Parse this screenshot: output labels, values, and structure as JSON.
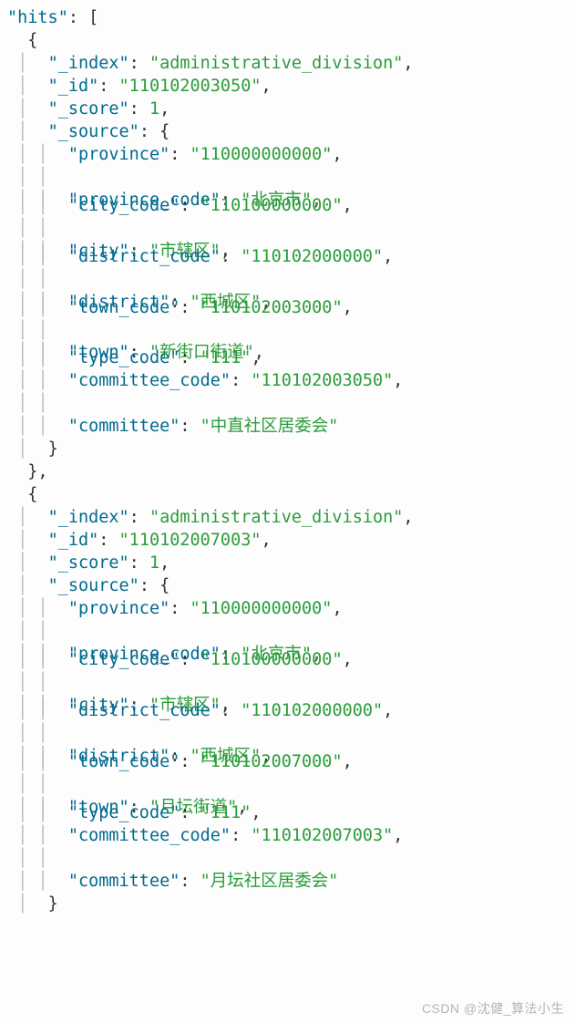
{
  "hits_key": "\"hits\"",
  "open_arr": ": [",
  "obj_open": "{",
  "obj_close": "}",
  "obj_close_comma": "},",
  "src_close": "}",
  "items": [
    {
      "index_k": "\"_index\"",
      "index_v": "\"administrative_division\"",
      "id_k": "\"_id\"",
      "id_v": "\"110102003050\"",
      "score_k": "\"_score\"",
      "score_v": "1",
      "source_k": "\"_source\"",
      "province_k": "\"province\"",
      "province_v": "\"110000000000\"",
      "province_code_k": "\"province_code\"",
      "province_code_v": "\"北京市\"",
      "city_code_k": "\"city_code\"",
      "city_code_v": "\"110100000000\"",
      "city_k": "\"city\"",
      "city_v": "\"市辖区\"",
      "district_code_k": "\"district_code\"",
      "district_code_v": "\"110102000000\"",
      "district_k": "\"district\"",
      "district_v": "\"西城区\"",
      "town_code_k": "\"town_code\"",
      "town_code_v": "\"110102003000\"",
      "town_k": "\"town\"",
      "town_v": "\"新街口街道\"",
      "type_code_k": "\"type_code\"",
      "type_code_v": "\"111\"",
      "committee_code_k": "\"committee_code\"",
      "committee_code_v": "\"110102003050\"",
      "committee_k": "\"committee\"",
      "committee_v": "\"中直社区居委会\""
    },
    {
      "index_k": "\"_index\"",
      "index_v": "\"administrative_division\"",
      "id_k": "\"_id\"",
      "id_v": "\"110102007003\"",
      "score_k": "\"_score\"",
      "score_v": "1",
      "source_k": "\"_source\"",
      "province_k": "\"province\"",
      "province_v": "\"110000000000\"",
      "province_code_k": "\"province_code\"",
      "province_code_v": "\"北京市\"",
      "city_code_k": "\"city_code\"",
      "city_code_v": "\"110100000000\"",
      "city_k": "\"city\"",
      "city_v": "\"市辖区\"",
      "district_code_k": "\"district_code\"",
      "district_code_v": "\"110102000000\"",
      "district_k": "\"district\"",
      "district_v": "\"西城区\"",
      "town_code_k": "\"town_code\"",
      "town_code_v": "\"110102007000\"",
      "town_k": "\"town\"",
      "town_v": "\"月坛街道\"",
      "type_code_k": "\"type_code\"",
      "type_code_v": "\"111\"",
      "committee_code_k": "\"committee_code\"",
      "committee_code_v": "\"110102007003\"",
      "committee_k": "\"committee\"",
      "committee_v": "\"月坛社区居委会\""
    }
  ],
  "watermark": "CSDN @沈健_算法小生"
}
